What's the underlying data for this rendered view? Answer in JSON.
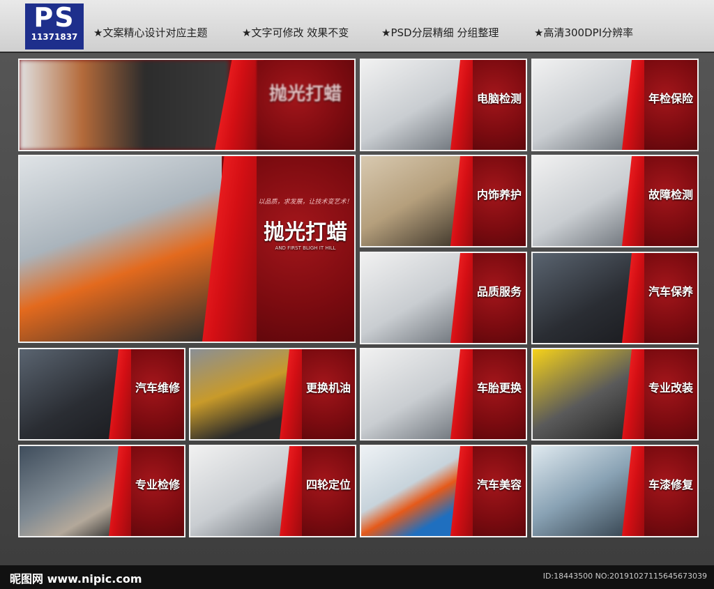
{
  "header": {
    "logo_text": "PS",
    "logo_number": "11371837",
    "features": [
      "★文案精心设计对应主题",
      "★文字可修改 效果不变",
      "★PSD分层精细 分组整理",
      "★高清300DPI分辨率"
    ]
  },
  "cards": [
    {
      "title": "抛光打蜡"
    },
    {
      "title": "电脑检测"
    },
    {
      "title": "年检保险"
    },
    {
      "title": "抛光打蜡",
      "tagline": "以品质，求发展，让技术变艺术！",
      "subtitle": "AND FIRST BLIGH IT HILL"
    },
    {
      "title": "内饰养护"
    },
    {
      "title": "故障检测"
    },
    {
      "title": "品质服务"
    },
    {
      "title": "汽车保养"
    },
    {
      "title": "汽车维修"
    },
    {
      "title": "更换机油"
    },
    {
      "title": "车胎更换"
    },
    {
      "title": "专业改装"
    },
    {
      "title": "专业检修"
    },
    {
      "title": "四轮定位"
    },
    {
      "title": "汽车美容"
    },
    {
      "title": "车漆修复"
    }
  ],
  "footer": {
    "watermark": "昵图网 www.nipic.com",
    "id_text": "ID:18443500 NO:20191027115645673039"
  }
}
